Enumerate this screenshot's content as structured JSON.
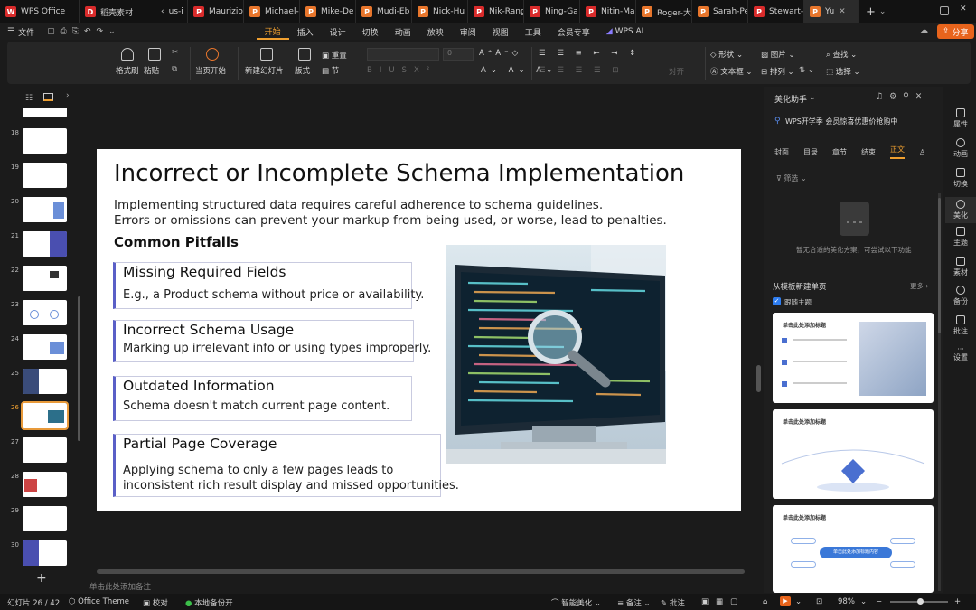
{
  "tabs": [
    {
      "label": "WPS Office",
      "color": "#d92b2b"
    },
    {
      "label": "稻壳素材",
      "color": "#d92b2b"
    },
    {
      "label": "us-i",
      "color": "#d92b2b"
    },
    {
      "label": "Maurizio",
      "color": "#d92b2b"
    },
    {
      "label": "Michael-",
      "color": "#e8762c"
    },
    {
      "label": "Mike-De",
      "color": "#e8762c"
    },
    {
      "label": "Mudi-Eb",
      "color": "#e8762c"
    },
    {
      "label": "Nick-Hu",
      "color": "#e8762c"
    },
    {
      "label": "Nik-Rang",
      "color": "#d92b2b"
    },
    {
      "label": "Ning-Ga",
      "color": "#d92b2b"
    },
    {
      "label": "Nitin-Ma",
      "color": "#d92b2b"
    },
    {
      "label": "Roger-大",
      "color": "#e8762c"
    },
    {
      "label": "Sarah-Pe",
      "color": "#e8762c"
    },
    {
      "label": "Stewart-",
      "color": "#d92b2b"
    },
    {
      "label": "Yu",
      "color": "#e8762c"
    }
  ],
  "menu": {
    "file": "文件",
    "items": [
      "开始",
      "插入",
      "设计",
      "切换",
      "动画",
      "放映",
      "审阅",
      "视图",
      "工具",
      "会员专享"
    ],
    "active": "开始",
    "ai": "WPS AI",
    "share": "分享"
  },
  "ribbon": {
    "format_painter": "格式刷",
    "paste": "粘贴",
    "play_from_current": "当页开始",
    "new_slide": "新建幻灯片",
    "layout": "版式",
    "section": "节",
    "reset": "重置",
    "align": "对齐",
    "shape": "形状",
    "picture": "图片",
    "find": "查找",
    "textbox": "文本框",
    "arrange": "排列",
    "select": "选择",
    "font_size": "0"
  },
  "thumbnails": [
    {
      "num": "18"
    },
    {
      "num": "19"
    },
    {
      "num": "20"
    },
    {
      "num": "21"
    },
    {
      "num": "22"
    },
    {
      "num": "23"
    },
    {
      "num": "24"
    },
    {
      "num": "25"
    },
    {
      "num": "26",
      "selected": true
    },
    {
      "num": "27"
    },
    {
      "num": "28"
    },
    {
      "num": "29"
    },
    {
      "num": "30"
    }
  ],
  "slide": {
    "title": "Incorrect or Incomplete Schema Implementation",
    "intro1": "Implementing structured data requires careful adherence to schema guidelines.",
    "intro2": "Errors or omissions can prevent your markup from being used, or worse, lead to penalties.",
    "pitfalls_heading": "Common Pitfalls",
    "pitfalls": [
      {
        "title": "Missing Required Fields",
        "desc": "E.g., a Product schema without price or availability."
      },
      {
        "title": "Incorrect Schema Usage",
        "desc": "Marking up irrelevant info or using types improperly."
      },
      {
        "title": "Outdated Information",
        "desc": "Schema doesn't match current page content."
      },
      {
        "title": "Partial Page Coverage",
        "desc": "Applying schema to only a few pages leads to",
        "desc2": " inconsistent rich result display and missed opportunities."
      }
    ]
  },
  "notes_placeholder": "单击此处添加备注",
  "right_panel": {
    "title": "美化助手",
    "promo": "WPS开学季 会员惊喜优惠价抢购中",
    "tabs": [
      "封面",
      "目录",
      "章节",
      "结束",
      "正文"
    ],
    "active_tab": "正文",
    "filter": "筛选",
    "empty_msg": "暂无合适的美化方案，可尝试以下功能",
    "new_from_template": "从模板新建单页",
    "more": "更多",
    "follow_theme": "跟随主题",
    "template_title": "单击此处添加标题",
    "template_center": "单击此处添加标题内容"
  },
  "right_strip": [
    "属性",
    "动画",
    "切换",
    "美化",
    "主题",
    "素材",
    "备份",
    "批注",
    "设置"
  ],
  "status": {
    "slide_counter": "幻灯片 26 / 42",
    "theme": "Office Theme",
    "proof": "校对",
    "backup": "本地备份开",
    "smart_beautify": "智能美化",
    "notes": "备注",
    "comments": "批注",
    "zoom": "98%"
  },
  "colors": {
    "accent": "#f0a030",
    "slide_border": "#5a5fc7",
    "share": "#e8641c"
  }
}
